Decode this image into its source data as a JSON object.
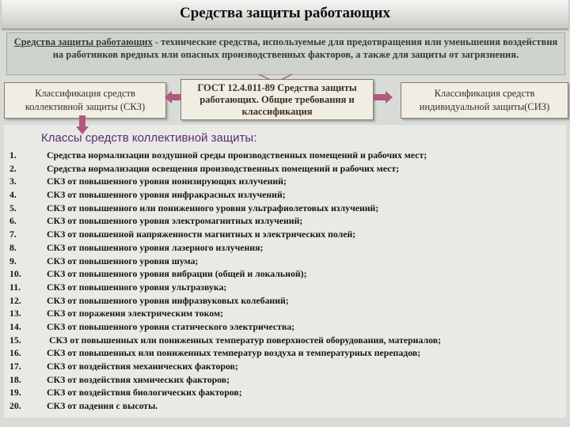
{
  "title": "Средства защиты работающих",
  "definition": {
    "term": "Средства защиты работающих",
    "text": " - технические средства, используемые для предотвращения или уменьшения воздействия на работников вредных или опасных производственных факторов, а также для защиты от загрязнения."
  },
  "boxes": {
    "skz": "Классификация средств коллективной защиты (СКЗ)",
    "gost": "ГОСТ 12.4.011-89 Средства защиты работающих. Общие требования и классификация",
    "siz": "Классификация средств индивидуальной защиты(СИЗ)"
  },
  "list_heading": "Классы средств коллективной защиты:",
  "items": [
    {
      "num": "1.",
      "text": "Средства нормализации воздушной среды производственных помещений и рабочих мест;"
    },
    {
      "num": "2.",
      "text": "Средства нормализации освещения производственных помещений и рабочих мест;"
    },
    {
      "num": "3.",
      "text": "СКЗ от повышенного уровня ионизирующих излучений;"
    },
    {
      "num": "4.",
      "text": "СКЗ от повышенного уровня инфракрасных излучений;"
    },
    {
      "num": "5.",
      "text": "СКЗ от повышенного или пониженного уровня ультрафиолетовых излучений;"
    },
    {
      "num": "6.",
      "text": "СКЗ от повышенного уровня электромагнитных излучений;"
    },
    {
      "num": "7.",
      "text": "СКЗ от повышенной напряженности магнитных и электрических полей;"
    },
    {
      "num": "8.",
      "text": "СКЗ от повышенного уровня лазерного излучения;"
    },
    {
      "num": "9.",
      "text": "СКЗ от повышенного уровня шума;"
    },
    {
      "num": "10.",
      "text": "СКЗ от повышенного уровня вибрации (общей и локальной);"
    },
    {
      "num": "11.",
      "text": "СКЗ от повышенного уровня ультразвука;"
    },
    {
      "num": "12.",
      "text": "СКЗ от повышенного уровня инфразвуковых колебаний;"
    },
    {
      "num": "13.",
      "text": "СКЗ от поражения электрическим током;"
    },
    {
      "num": "14.",
      "text": "СКЗ от повышенного уровня статического электричества;"
    },
    {
      "num": "15.",
      "text": " СКЗ от повышенных или пониженных температур поверхностей оборудования, материалов;"
    },
    {
      "num": "16.",
      "text": "СКЗ от повышенных или пониженных температур воздуха и температурных перепадов;"
    },
    {
      "num": "17.",
      "text": "СКЗ от воздействия механических факторов;"
    },
    {
      "num": "18.",
      "text": "СКЗ от воздействия химических факторов;"
    },
    {
      "num": "19.",
      "text": "СКЗ от воздействия биологических факторов;"
    },
    {
      "num": "20.",
      "text": "СКЗ от падения с высоты."
    }
  ],
  "colors": {
    "arrow": "#b0587e",
    "heading": "#5a2d74",
    "box_border": "#8a7a66"
  }
}
